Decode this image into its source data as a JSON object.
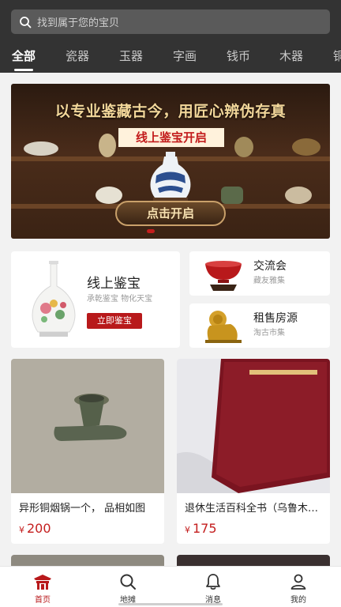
{
  "search": {
    "placeholder": "找到属于您的宝贝",
    "icon": "search-icon"
  },
  "tabs": [
    {
      "label": "全部",
      "active": true
    },
    {
      "label": "瓷器",
      "active": false
    },
    {
      "label": "玉器",
      "active": false
    },
    {
      "label": "字画",
      "active": false
    },
    {
      "label": "钱币",
      "active": false
    },
    {
      "label": "木器",
      "active": false
    },
    {
      "label": "铜",
      "active": false
    }
  ],
  "banner": {
    "title": "以专业鉴藏古今，用匠心辨伪存真",
    "subtitle": "线上鉴宝开启",
    "button": "点击开启"
  },
  "services": {
    "main": {
      "title": "线上鉴宝",
      "desc": "承乾鉴宝 物化天宝",
      "button": "立即鉴宝",
      "icon": "porcelain-vase-icon"
    },
    "items": [
      {
        "title": "交流会",
        "desc": "藏友雅集",
        "icon": "ceramic-bowl-icon"
      },
      {
        "title": "租售房源",
        "desc": "淘古市集",
        "icon": "golden-lion-icon"
      }
    ]
  },
  "products": [
    {
      "name": "异形铜烟锅一个，  品相如图",
      "currency": "¥",
      "price": "200"
    },
    {
      "name": "退休生活百科全书（乌鲁木齐）",
      "currency": "¥",
      "price": "175"
    }
  ],
  "bottom_nav": [
    {
      "label": "首页",
      "icon": "home-pavilion-icon",
      "active": true
    },
    {
      "label": "地摊",
      "icon": "search-icon",
      "active": false
    },
    {
      "label": "消息",
      "icon": "bell-icon",
      "active": false
    },
    {
      "label": "我的",
      "icon": "user-icon",
      "active": false
    }
  ],
  "colors": {
    "header_bg": "#333333",
    "accent": "#b8191b",
    "price": "#c41e1e",
    "page_bg": "#f2f2f2"
  }
}
